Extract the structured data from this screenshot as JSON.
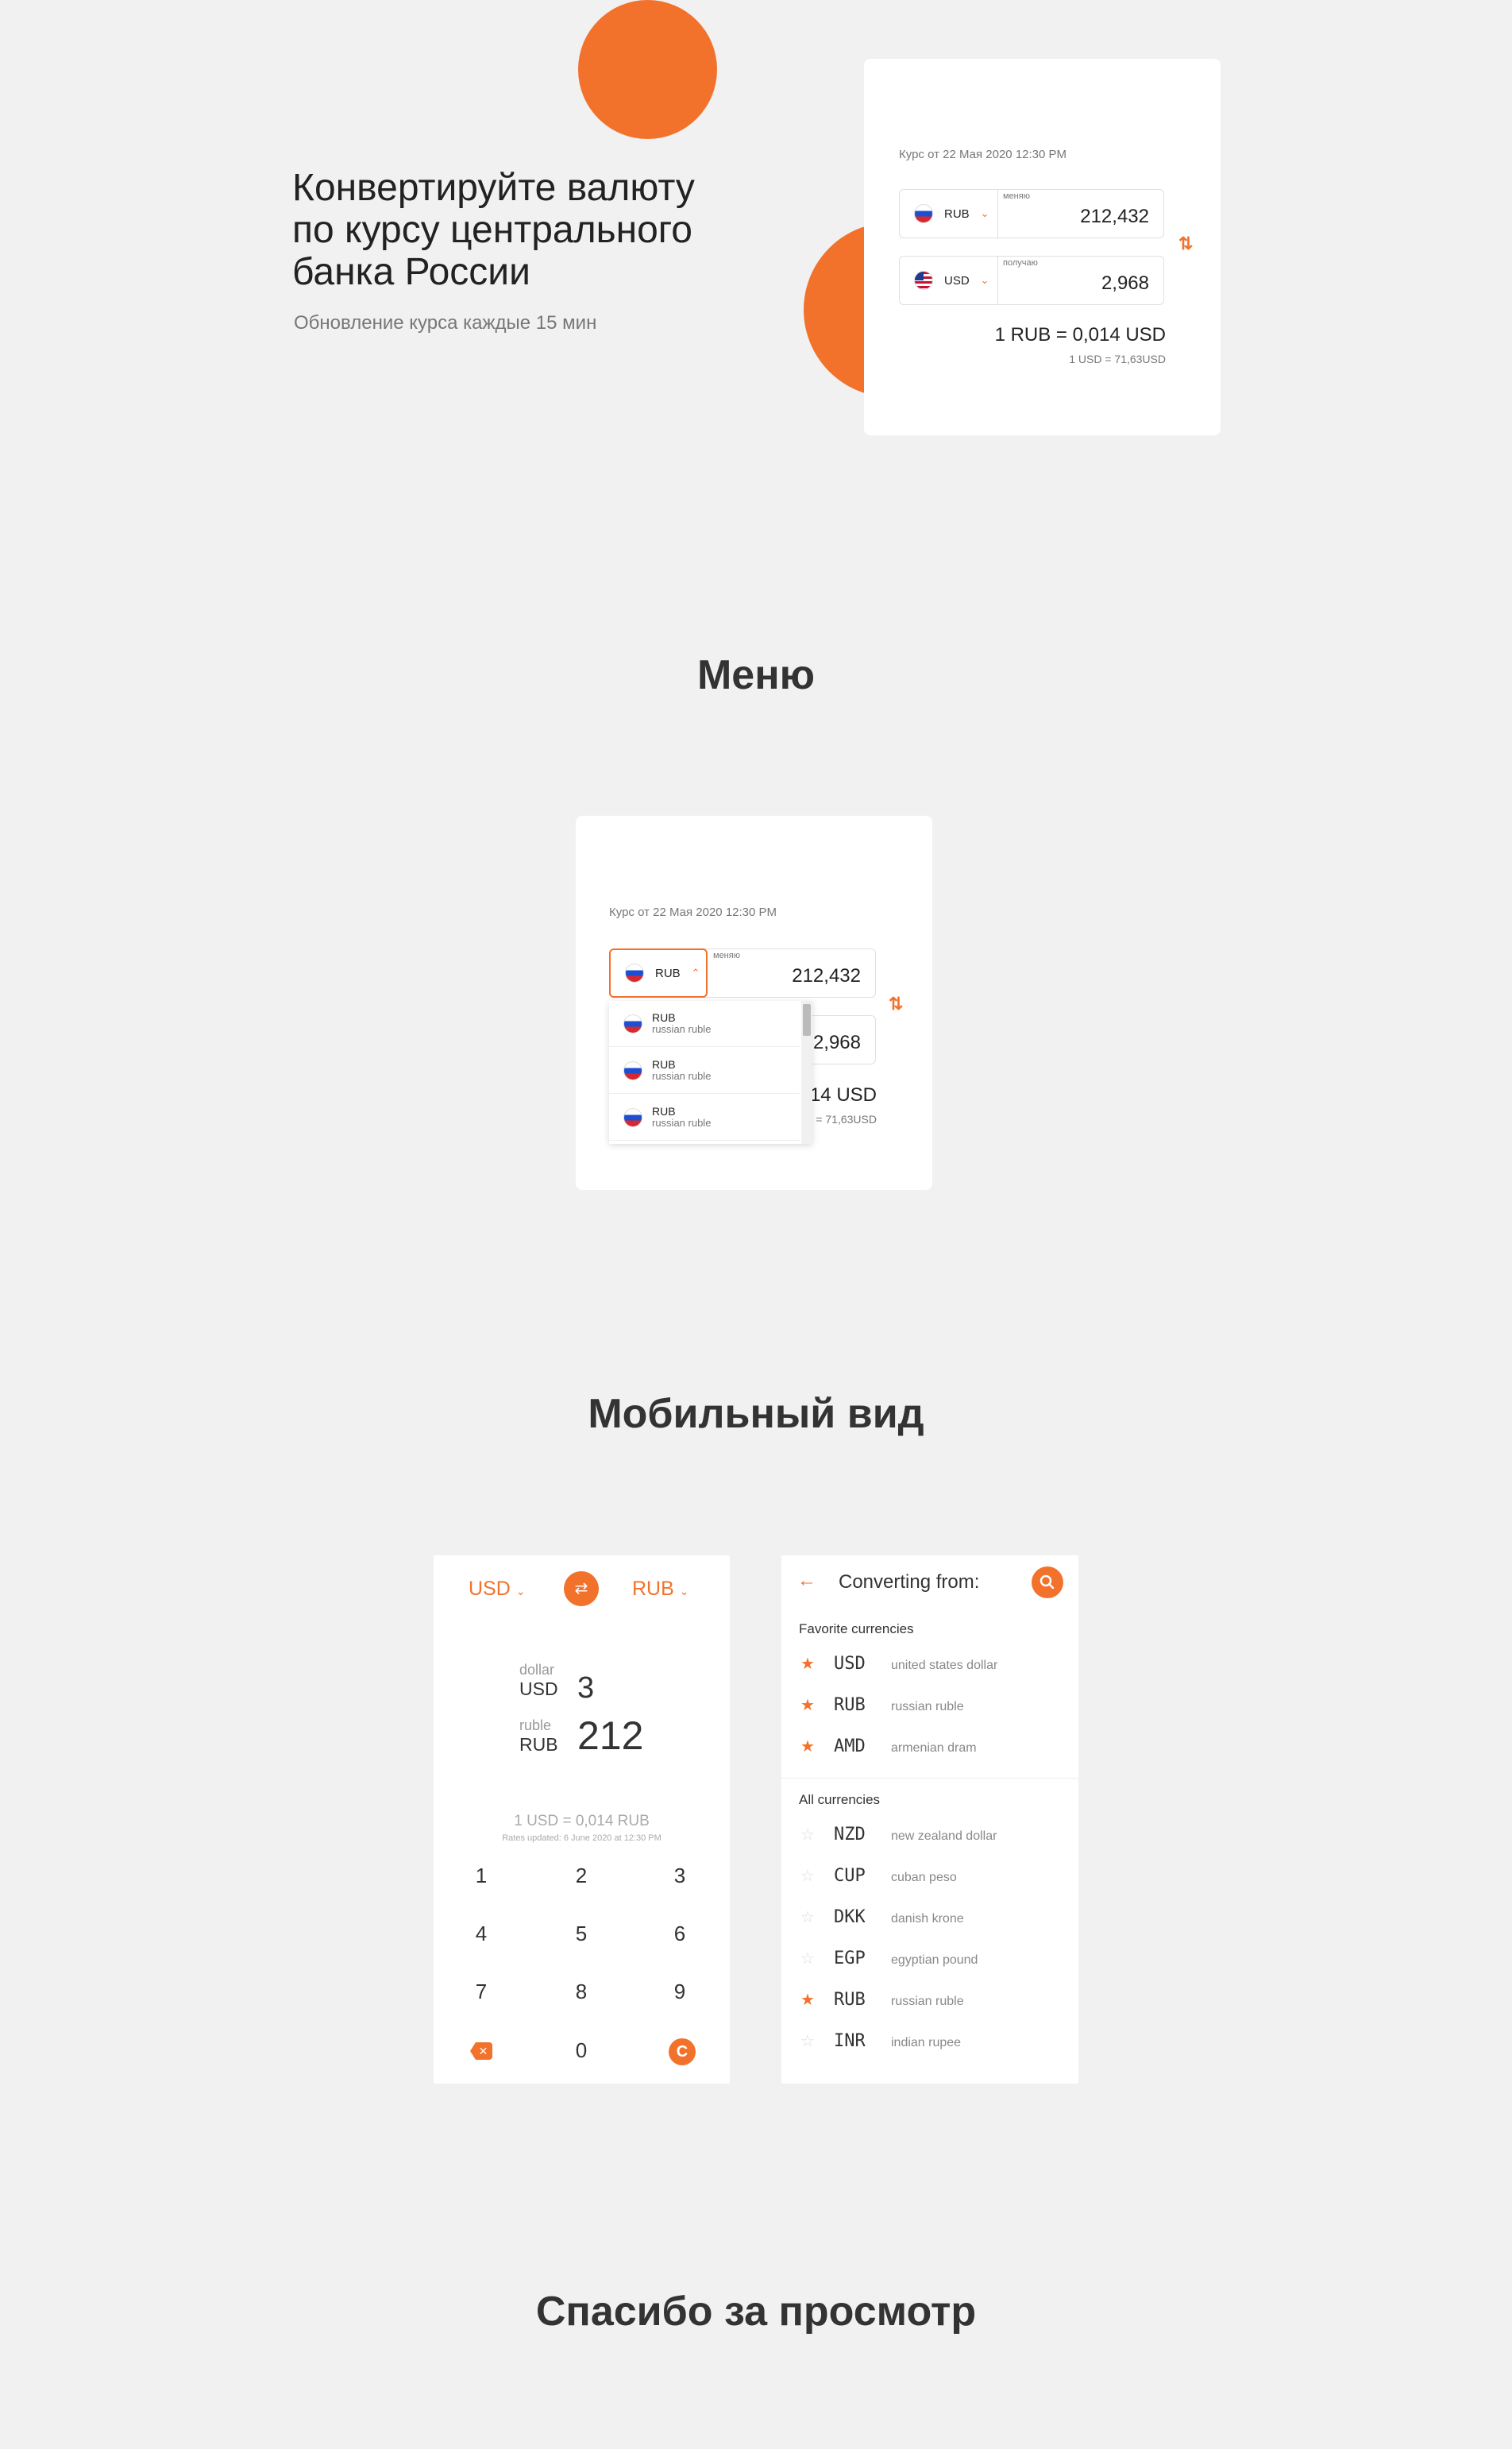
{
  "hero": {
    "title_lines": [
      "Конвертируйте валюту",
      "по курсу центрального",
      "банка России"
    ],
    "subtitle": "Обновление курса каждые 15 мин"
  },
  "converter": {
    "rate_date": "Курс от 22 Мая 2020 12:30 PM",
    "from": {
      "code": "RUB",
      "label": "меняю",
      "value": "212,432"
    },
    "to": {
      "code": "USD",
      "label": "получаю",
      "value": "2,968"
    },
    "rate_main": "1 RUB = 0,014 USD",
    "rate_sub": "1 USD = 71,63USD"
  },
  "menu_section": {
    "title": "Меню",
    "rate_date": "Курс от 22 Мая 2020 12:30 PM",
    "from": {
      "code": "RUB",
      "label": "меняю",
      "value": "212,432"
    },
    "to_value_partial": "2,968",
    "rate_main_partial": "14 USD",
    "rate_sub_partial": "= 71,63USD",
    "dropdown": [
      {
        "code": "RUB",
        "name": "russian ruble"
      },
      {
        "code": "RUB",
        "name": "russian ruble"
      },
      {
        "code": "RUB",
        "name": "russian ruble"
      }
    ]
  },
  "mobile_section": {
    "title": "Мобильный вид",
    "calc": {
      "from_code": "USD",
      "to_code": "RUB",
      "row1": {
        "name": "dollar",
        "code": "USD",
        "value": "3"
      },
      "row2": {
        "name": "ruble",
        "code": "RUB",
        "value": "212"
      },
      "rate": "1 USD = 0,014 RUB",
      "updated": "Rates updated:  6 June 2020 at 12:30 PM",
      "keys": [
        "1",
        "2",
        "3",
        "4",
        "5",
        "6",
        "7",
        "8",
        "9",
        "0"
      ],
      "clear_label": "C"
    },
    "picker": {
      "header": "Converting from:",
      "favorites_title": "Favorite currencies",
      "favorites": [
        {
          "code": "USD",
          "name": "united states dollar",
          "starred": true
        },
        {
          "code": "RUB",
          "name": "russian ruble",
          "starred": true
        },
        {
          "code": "AMD",
          "name": "armenian dram",
          "starred": true
        }
      ],
      "all_title": "All currencies",
      "all": [
        {
          "code": "NZD",
          "name": "new zealand dollar",
          "starred": false
        },
        {
          "code": "CUP",
          "name": "cuban peso",
          "starred": false
        },
        {
          "code": "DKK",
          "name": "danish krone",
          "starred": false
        },
        {
          "code": "EGP",
          "name": "egyptian pound",
          "starred": false
        },
        {
          "code": "RUB",
          "name": "russian ruble",
          "starred": true
        },
        {
          "code": "INR",
          "name": "indian rupee",
          "starred": false
        }
      ]
    }
  },
  "footer": {
    "title": "Спасибо за просмотр"
  },
  "colors": {
    "accent": "#f2722c",
    "background": "#f1f1f1",
    "card": "#ffffff"
  }
}
